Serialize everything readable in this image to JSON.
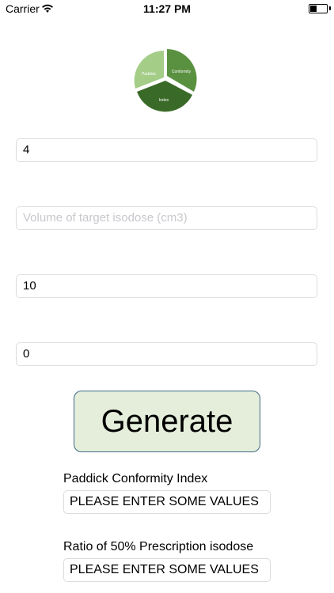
{
  "status_bar": {
    "carrier": "Carrier",
    "time": "11:27 PM"
  },
  "logo": {
    "labels": [
      "Paddick",
      "Conformity",
      "Index"
    ],
    "colors": [
      "#a4cd88",
      "#5a9140",
      "#3a6a28"
    ]
  },
  "form": {
    "field1": {
      "value": "4",
      "placeholder": ""
    },
    "field2": {
      "value": "",
      "placeholder": "Volume of target isodose (cm3)"
    },
    "field3": {
      "value": "10",
      "placeholder": ""
    },
    "field4": {
      "value": "0",
      "placeholder": ""
    }
  },
  "generate_label": "Generate",
  "results": {
    "paddick_label": "Paddick Conformity Index",
    "paddick_value": "PLEASE ENTER SOME VALUES",
    "ratio_label": "Ratio of 50% Prescription isodose",
    "ratio_value": "PLEASE ENTER SOME VALUES"
  }
}
